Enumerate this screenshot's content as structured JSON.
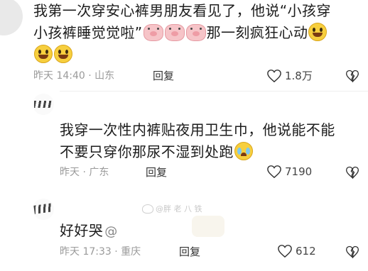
{
  "comments": [
    {
      "segments_line1": [
        "我第一次穿安心裤男朋友看见了，他说“小孩穿"
      ],
      "line2_text": "小孩裤睡觉觉啦”",
      "line2_after": "那一刻疯狂心动",
      "time": "昨天 14:40",
      "separator": "·",
      "location": "山东",
      "reply": "回复",
      "likes": "1.8万"
    },
    {
      "line1": "我穿一次性内裤贴夜用卫生巾，他说能不能",
      "line2": "不要只穿你那尿不湿到处跑",
      "time": "昨天",
      "separator": "·",
      "location": "广东",
      "reply": "回复",
      "likes": "7190"
    },
    {
      "line1": "好好哭",
      "at_symbol": "@",
      "watermark": "@胖 老 八 铁",
      "time": "昨天 17:33",
      "separator": "·",
      "location": "重庆",
      "reply": "回复",
      "likes": "612"
    }
  ],
  "icons": {
    "like": "heart-outline-icon",
    "dislike": "broken-heart-icon",
    "emoji_grin": "grinning-face-emoji",
    "emoji_pig": "pig-face-emoji",
    "emoji_cry": "crying-laughing-emoji"
  }
}
